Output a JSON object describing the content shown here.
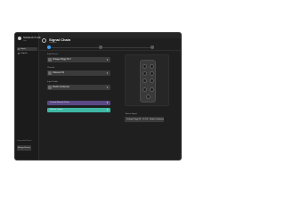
{
  "app": {
    "name": "SIGNALOUT LIVE",
    "subtitle": "Lab"
  },
  "sidebar": {
    "items": [
      {
        "label": "Inputs",
        "active": true
      },
      {
        "label": "Outputs",
        "active": false
      }
    ],
    "bottom_label": "Connected Device",
    "bottom_button": "Manage Devices"
  },
  "header": {
    "title": "Signal Chain",
    "subtitle": "Configure"
  },
  "steps": {
    "count": 3,
    "current": 1
  },
  "form": {
    "device_label": "Input Device",
    "device_value": "Vintage Plugg 3S V",
    "channel_label": "Channel",
    "channel_value": "Channel 3/4",
    "profile_label": "Input Profile",
    "profile_value": "Studio Condenser",
    "effect_bar": {
      "label": "Custom Reverb Chain",
      "color": "#5b4a86"
    },
    "output_bar": {
      "label": "Monitor Output",
      "color": "#3fb7a4"
    }
  },
  "preview": {
    "section_label": "Active Signal",
    "readout": "Vintage Plugg 3S · Ch 3/4 · Studio Condenser"
  }
}
